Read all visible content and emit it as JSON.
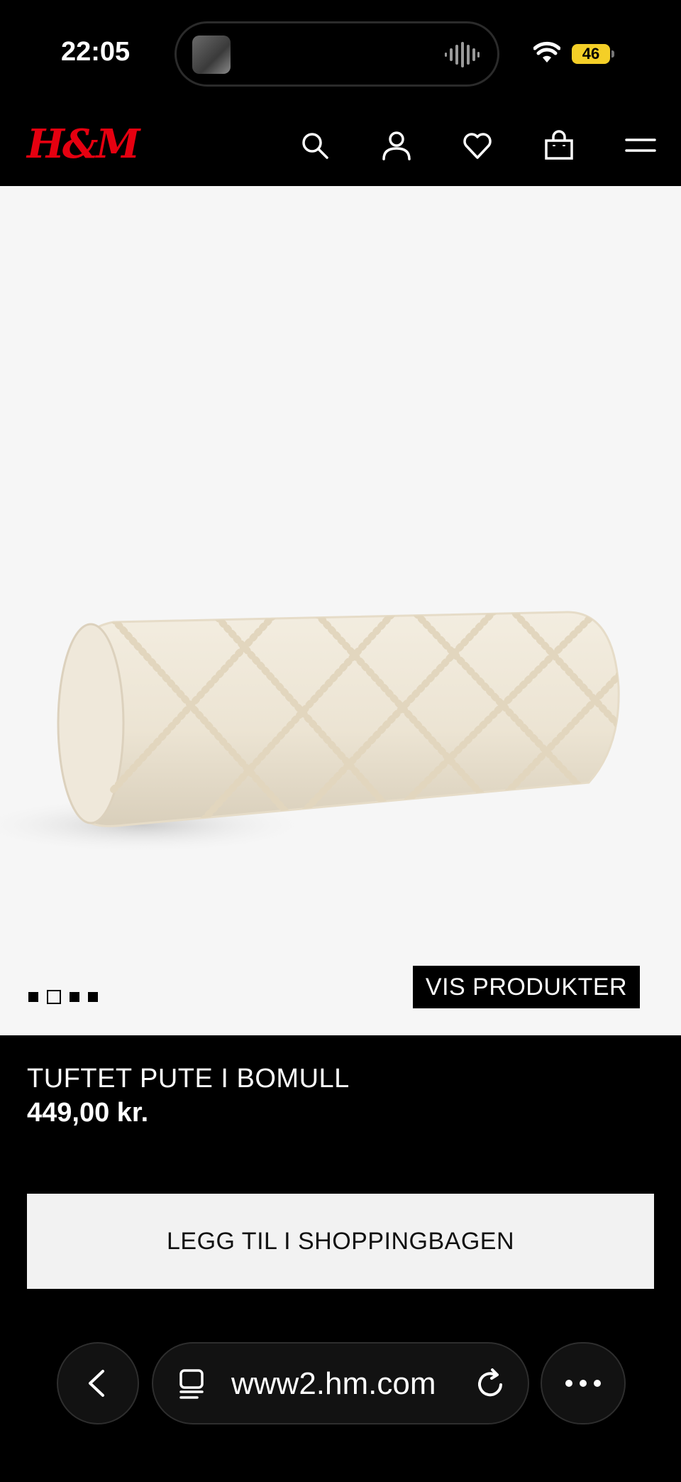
{
  "status_bar": {
    "time": "22:05",
    "battery": "46"
  },
  "header": {
    "logo": "H&M",
    "icons": [
      "search-icon",
      "account-icon",
      "heart-icon",
      "bag-icon",
      "menu-icon"
    ]
  },
  "hero": {
    "image_slides": 4,
    "active_slide": 2,
    "cta_label": "VIS PRODUKTER"
  },
  "product": {
    "title": "TUFTET PUTE I BOMULL",
    "price": "449,00 kr.",
    "add_to_bag_label": "LEGG TIL I SHOPPINGBAGEN"
  },
  "browser": {
    "url": "www2.hm.com",
    "icons": [
      "back-icon",
      "tabs-icon",
      "reload-icon",
      "more-icon"
    ]
  },
  "colors": {
    "brand_red": "#e50010",
    "background": "#000000",
    "hero_bg": "#f6f6f6",
    "battery": "#f4cf27"
  }
}
